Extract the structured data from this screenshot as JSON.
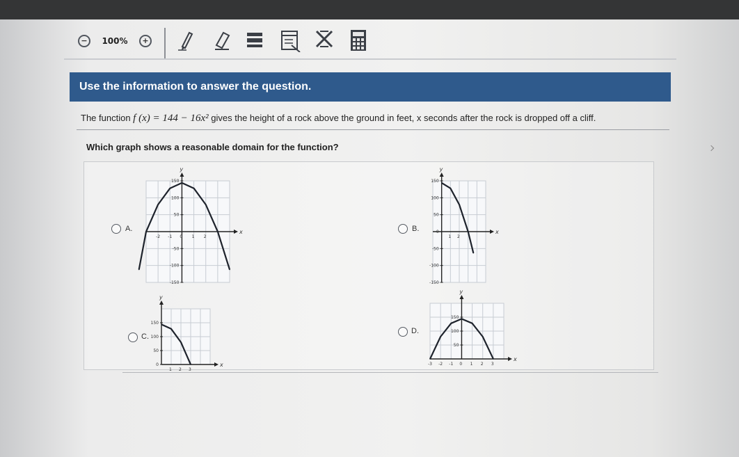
{
  "toolbar": {
    "zoom_level": "100%",
    "items": [
      "zoom-out-icon",
      "zoom-in-icon",
      "pencil-icon",
      "eraser-icon",
      "highlighter-icon",
      "notepad-icon",
      "eliminate-choice-icon",
      "calculator-icon"
    ]
  },
  "header": {
    "title": "Use the information to answer the question."
  },
  "stem": {
    "prefix": "The function",
    "function": "f (x) = 144 − 16x²",
    "suffix": "gives the height of a rock above the ground in feet, x seconds after the rock is dropped off a cliff."
  },
  "question": {
    "text": "Which graph shows a reasonable domain for the function?"
  },
  "colors": {
    "header_bg": "#2f5a8c",
    "curve": "#1e232c",
    "grid": "#c7ccd3"
  },
  "options": [
    {
      "letter": "A.",
      "chart_data": {
        "type": "line",
        "x": [
          -4,
          -3,
          -2,
          -1,
          0,
          1,
          2,
          3,
          4
        ],
        "y": [
          -112,
          0,
          80,
          128,
          144,
          128,
          80,
          0,
          -112
        ],
        "xlim": [
          -3,
          4
        ],
        "ylim": [
          -150,
          150
        ],
        "xlabel": "x",
        "ylabel": "y",
        "x_ticks": [
          "-2",
          "-1",
          "0",
          "1",
          "2"
        ],
        "y_ticks": [
          "150",
          "100",
          "50",
          "-50",
          "-100",
          "-150"
        ]
      }
    },
    {
      "letter": "B.",
      "chart_data": {
        "type": "line",
        "x": [
          0,
          1,
          2,
          3,
          3.6
        ],
        "y": [
          144,
          128,
          80,
          0,
          -63
        ],
        "xlim": [
          -1,
          5
        ],
        "ylim": [
          -150,
          150
        ],
        "xlabel": "x",
        "ylabel": "y",
        "x_ticks": [
          "1",
          "2"
        ],
        "y_ticks": [
          "150",
          "100",
          "50",
          "0",
          "-50",
          "-100",
          "-150"
        ]
      }
    },
    {
      "letter": "C.",
      "chart_data": {
        "type": "line",
        "x": [
          0,
          1,
          2,
          3
        ],
        "y": [
          144,
          128,
          80,
          0
        ],
        "xlim": [
          0,
          5
        ],
        "ylim": [
          0,
          200
        ],
        "xlabel": "x",
        "ylabel": "y",
        "x_ticks": [
          "1",
          "2",
          "3"
        ],
        "y_ticks": [
          "150",
          "100",
          "50",
          "0"
        ]
      }
    },
    {
      "letter": "D.",
      "chart_data": {
        "type": "line",
        "x": [
          -3,
          -2,
          -1,
          0,
          1,
          2,
          3
        ],
        "y": [
          0,
          80,
          128,
          144,
          128,
          80,
          0
        ],
        "xlim": [
          -3,
          4
        ],
        "ylim": [
          0,
          200
        ],
        "xlabel": "x",
        "ylabel": "y",
        "x_ticks": [
          "-3",
          "-2",
          "-1",
          "0",
          "1",
          "2",
          "3"
        ],
        "y_ticks": [
          "150",
          "100",
          "50"
        ]
      }
    }
  ]
}
